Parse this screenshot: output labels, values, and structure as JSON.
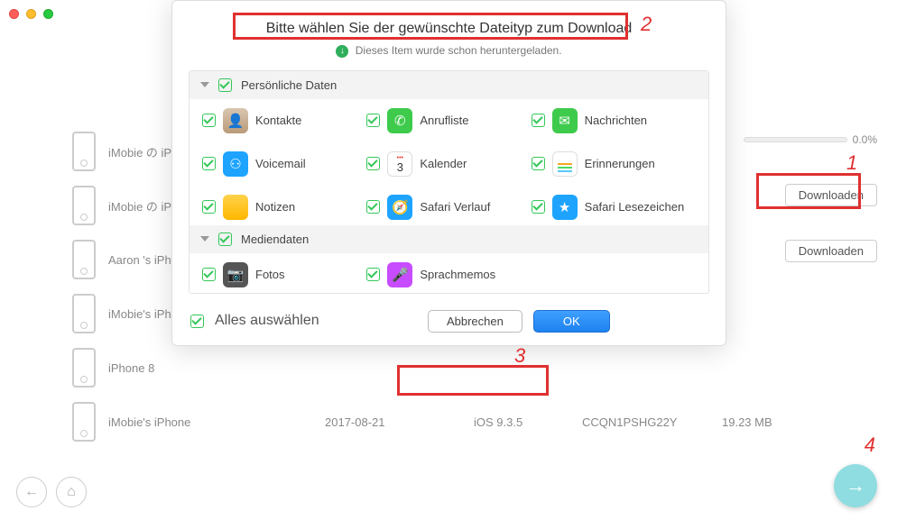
{
  "modal": {
    "title": "Bitte wählen Sie der gewünschte Dateityp zum Download",
    "already": "Dieses Item wurde schon heruntergeladen.",
    "section_personal": "Persönliche Daten",
    "section_media": "Mediendaten",
    "items": {
      "contacts": "Kontakte",
      "calls": "Anrufliste",
      "messages": "Nachrichten",
      "voicemail": "Voicemail",
      "calendar": "Kalender",
      "reminders": "Erinnerungen",
      "notes": "Notizen",
      "safari_history": "Safari Verlauf",
      "safari_bookmarks": "Safari Lesezeichen",
      "photos": "Fotos",
      "voicememos": "Sprachmemos"
    },
    "calendar_day": "3",
    "select_all": "Alles auswählen",
    "cancel": "Abbrechen",
    "ok": "OK"
  },
  "bg": {
    "rows": [
      {
        "name": "iMobie の iP"
      },
      {
        "name": "iMobie の iP"
      },
      {
        "name": "Aaron 's iPh"
      },
      {
        "name": "iMobie's iPh"
      },
      {
        "name": "iPhone 8"
      },
      {
        "name": "iMobie's iPhone",
        "date": "2017-08-21",
        "ios": "iOS 9.3.5",
        "udid": "CCQN1PSHG22Y",
        "size": "19.23 MB"
      }
    ],
    "pct": "0.0%",
    "download": "Downloaden"
  },
  "ann": {
    "n1": "1",
    "n2": "2",
    "n3": "3",
    "n4": "4"
  }
}
